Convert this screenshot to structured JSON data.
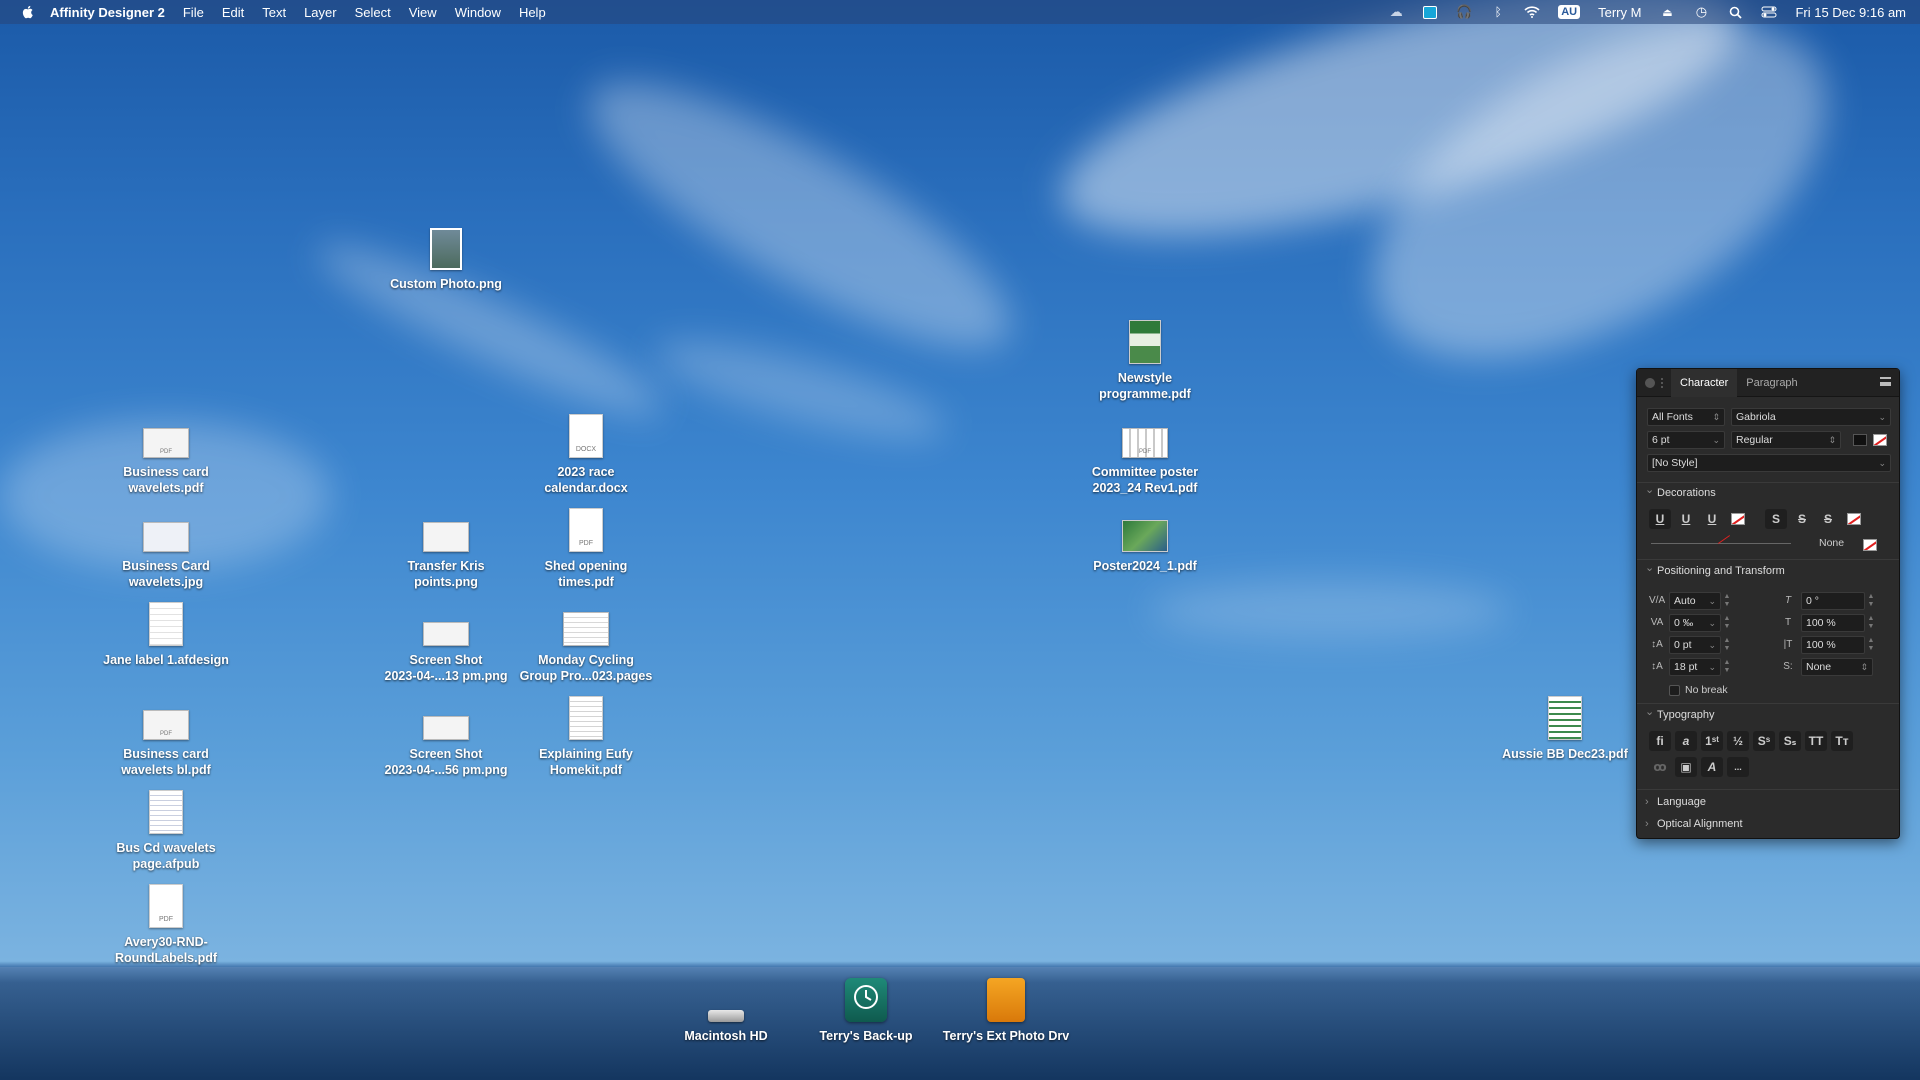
{
  "menubar": {
    "app_name": "Affinity Designer 2",
    "items": [
      "File",
      "Edit",
      "Text",
      "Layer",
      "Select",
      "View",
      "Window",
      "Help"
    ],
    "input_source": "AU",
    "user": "Terry M",
    "datetime": "Fri 15 Dec  9:16 am"
  },
  "desktop_icons": [
    {
      "label": "Custom Photo.png",
      "kind": "photo"
    },
    {
      "label": "Newstyle\nprogramme.pdf",
      "kind": "brochure"
    },
    {
      "label": "Business card\nwavelets.pdf",
      "kind": "card-pdf"
    },
    {
      "label": "2023 race\ncalendar.docx",
      "kind": "docx"
    },
    {
      "label": "Committee poster\n2023_24 Rev1.pdf",
      "kind": "poster-pdf"
    },
    {
      "label": "Business Card\nwavelets.jpg",
      "kind": "card"
    },
    {
      "label": "Transfer Kris\npoints.png",
      "kind": "card"
    },
    {
      "label": "Shed opening\ntimes.pdf",
      "kind": "pdf"
    },
    {
      "label": "Poster2024_1.pdf",
      "kind": "photo-pdf"
    },
    {
      "label": "Jane label 1.afdesign",
      "kind": "doc"
    },
    {
      "label": "Screen Shot\n2023-04-...13 pm.png",
      "kind": "card"
    },
    {
      "label": "Monday Cycling\nGroup Pro...023.pages",
      "kind": "pages"
    },
    {
      "label": "Business card\nwavelets bl.pdf",
      "kind": "card-pdf"
    },
    {
      "label": "Screen Shot\n2023-04-...56 pm.png",
      "kind": "card"
    },
    {
      "label": "Explaining Eufy\nHomekit.pdf",
      "kind": "doc"
    },
    {
      "label": "Aussie BB Dec23.pdf",
      "kind": "sheet"
    },
    {
      "label": "Bus Cd wavelets\npage.afpub",
      "kind": "doc"
    },
    {
      "label": "Avery30-RND-\nRoundLabels.pdf",
      "kind": "pdf"
    }
  ],
  "drives": [
    {
      "label": "Macintosh HD",
      "icon": "internal-disk-icon"
    },
    {
      "label": "Terry's Back-up",
      "icon": "time-machine-icon"
    },
    {
      "label": "Terry's Ext Photo Drv",
      "icon": "external-drive-icon"
    }
  ],
  "panel": {
    "tabs": [
      "Character",
      "Paragraph"
    ],
    "font_collection": "All Fonts",
    "font_family": "Gabriola",
    "font_size": "6 pt",
    "font_style": "Regular",
    "text_style": "[No Style]",
    "sections": {
      "decorations": "Decorations",
      "positioning": "Positioning and Transform",
      "typography": "Typography",
      "language": "Language",
      "optical": "Optical Alignment"
    },
    "decoration_line": "None",
    "positioning_fields": {
      "kerning": "Auto",
      "tracking": "0 ‰",
      "baseline": "0 pt",
      "leading": "18 pt",
      "shear": "0 °",
      "vscale": "100 %",
      "hscale": "100 %",
      "position": "None"
    },
    "no_break": "No break",
    "more": "..."
  },
  "colors": {
    "panel_bg": "#2b2b2b",
    "accent_none": "#e02020"
  }
}
